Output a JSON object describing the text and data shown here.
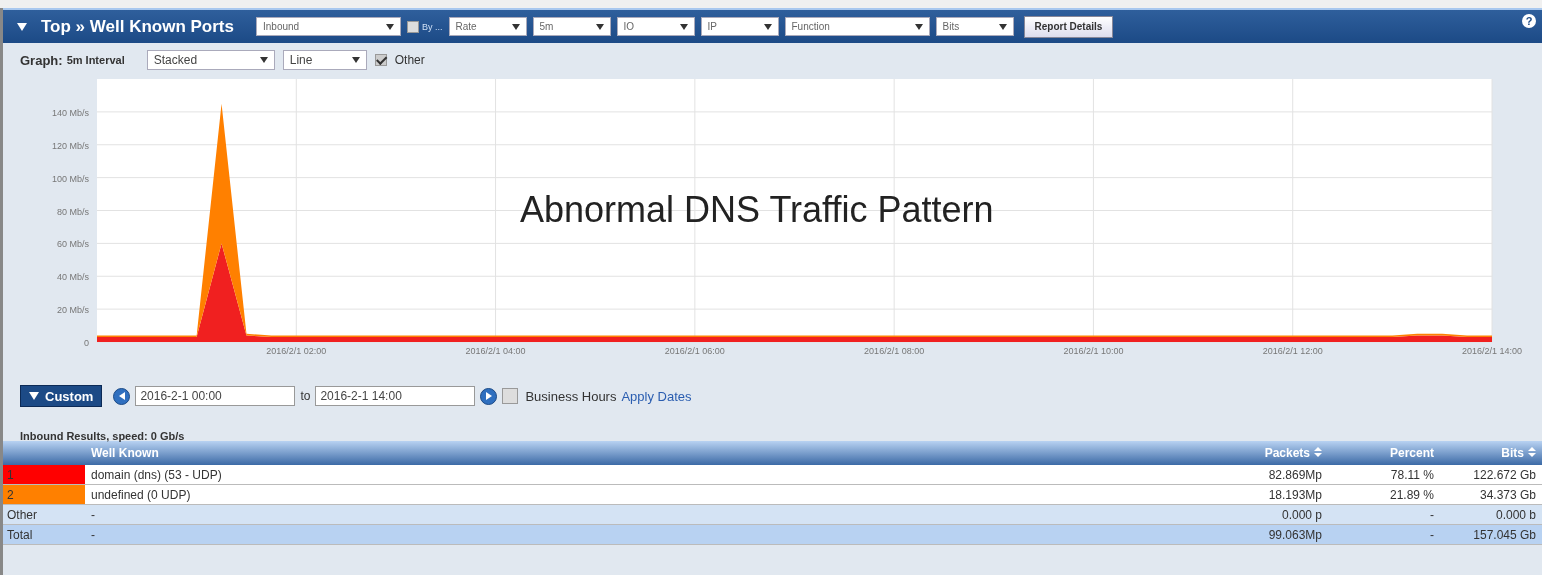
{
  "header": {
    "title": "Top » Well Known Ports",
    "filters": [
      {
        "kind": "select",
        "value": "Inbound"
      },
      {
        "kind": "checkbox",
        "label": "By ...",
        "checked": false
      },
      {
        "kind": "select",
        "value": "Rate"
      },
      {
        "kind": "select",
        "value": "5m"
      },
      {
        "kind": "select",
        "value": "IO"
      },
      {
        "kind": "select",
        "value": "IP"
      },
      {
        "kind": "select",
        "value": "Function"
      },
      {
        "kind": "select",
        "value": "Bits"
      }
    ],
    "button": "Report Details",
    "help": "?"
  },
  "graph_bar": {
    "label": "Graph:",
    "interval": "5m Interval",
    "mode": "Stacked",
    "style": "Line",
    "other": {
      "label": "Other",
      "checked": true
    }
  },
  "graph": {
    "caption": "Abnormal DNS Traffic Pattern",
    "chart_data": {
      "type": "area",
      "stacked": true,
      "categories": [
        null,
        null,
        null,
        null,
        null,
        null,
        null,
        null,
        "2016/2/1 02:00",
        null,
        null,
        null,
        null,
        null,
        null,
        null,
        "2016/2/1 04:00",
        null,
        null,
        null,
        null,
        null,
        null,
        null,
        "2016/2/1 06:00",
        null,
        null,
        null,
        null,
        null,
        null,
        null,
        "2016/2/1 08:00",
        null,
        null,
        null,
        null,
        null,
        null,
        null,
        "2016/2/1 10:00",
        null,
        null,
        null,
        null,
        null,
        null,
        null,
        "2016/2/1 12:00",
        null,
        null,
        null,
        null,
        null,
        null,
        null,
        "2016/2/1 14:00"
      ],
      "series": [
        {
          "color": "#f02020",
          "values": [
            3,
            3,
            3,
            3,
            3,
            60,
            4,
            3,
            3,
            3,
            3,
            3,
            3,
            3,
            3,
            3,
            3,
            3,
            3,
            3,
            3,
            3,
            3,
            3,
            3,
            3,
            3,
            3,
            3,
            3,
            3,
            3,
            3,
            3,
            3,
            3,
            3,
            3,
            3,
            3,
            3,
            3,
            3,
            3,
            3,
            3,
            3,
            3,
            3,
            3,
            3,
            3,
            3,
            4,
            4,
            3,
            3
          ]
        },
        {
          "color": "#ff8000",
          "values": [
            1,
            1,
            1,
            1,
            1,
            85,
            1,
            1,
            1,
            1,
            1,
            1,
            1,
            1,
            1,
            1,
            1,
            1,
            1,
            1,
            1,
            1,
            1,
            1,
            1,
            1,
            1,
            1,
            1,
            1,
            1,
            1,
            1,
            1,
            1,
            1,
            1,
            1,
            1,
            1,
            1,
            1,
            1,
            1,
            1,
            1,
            1,
            1,
            1,
            1,
            1,
            1,
            1,
            1,
            1,
            1,
            1
          ]
        }
      ],
      "ylim": [
        0,
        160
      ],
      "grid": true,
      "yticks": [
        {
          "value": 0,
          "label": "0"
        },
        {
          "value": 20,
          "label": "20 Mb/s"
        },
        {
          "value": 40,
          "label": "40 Mb/s"
        },
        {
          "value": 60,
          "label": "60 Mb/s"
        },
        {
          "value": 80,
          "label": "80 Mb/s"
        },
        {
          "value": 100,
          "label": "100 Mb/s"
        },
        {
          "value": 120,
          "label": "120 Mb/s"
        },
        {
          "value": 140,
          "label": "140 Mb/s"
        }
      ]
    }
  },
  "range": {
    "preset": "Custom",
    "from": "2016-2-1 00:00",
    "to_label": "to",
    "to": "2016-2-1 14:00",
    "business_hours": {
      "label": "Business Hours",
      "checked": false
    },
    "apply": "Apply Dates"
  },
  "results": {
    "title": "Inbound Results, speed: 0 Gb/s",
    "columns": [
      {
        "label": "Well Known",
        "sort": false
      },
      {
        "label": "Packets",
        "sort": true
      },
      {
        "label": "Percent",
        "sort": false
      },
      {
        "label": "Bits",
        "sort": true
      }
    ],
    "rows": [
      {
        "kind": "item",
        "rank": "1",
        "color": "#ff0000",
        "name": "domain (dns) (53 - UDP)",
        "packets": "82.869Mp",
        "percent": "78.11 %",
        "bits": "122.672 Gb"
      },
      {
        "kind": "item",
        "rank": "2",
        "color": "#ff8000",
        "name": "undefined (0 UDP)",
        "packets": "18.193Mp",
        "percent": "21.89 %",
        "bits": "34.373 Gb"
      },
      {
        "kind": "other",
        "rank": "Other",
        "name": "-",
        "packets": "0.000 p",
        "percent": "-",
        "bits": "0.000 b"
      },
      {
        "kind": "total",
        "rank": "Total",
        "name": "-",
        "packets": "99.063Mp",
        "percent": "-",
        "bits": "157.045 Gb"
      }
    ]
  }
}
